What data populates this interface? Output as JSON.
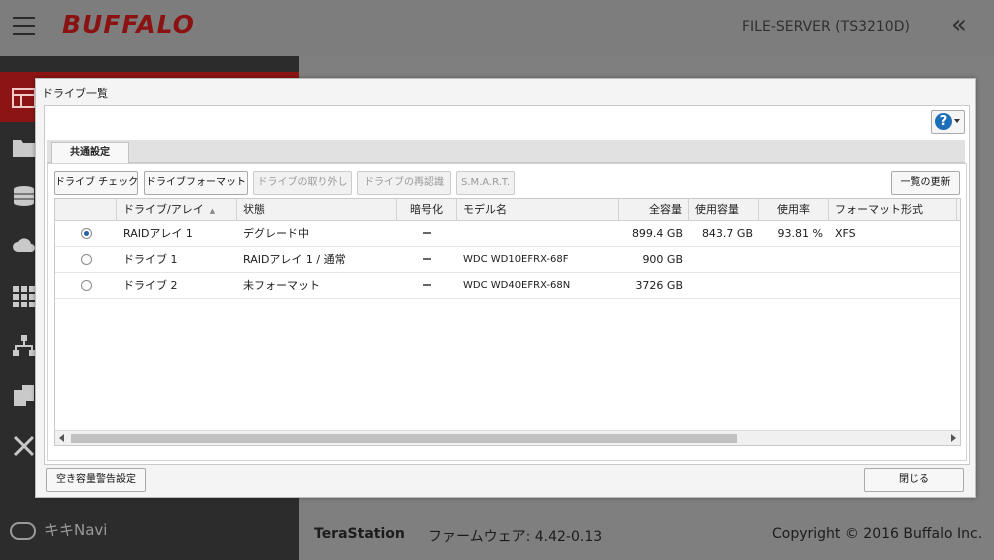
{
  "app": {
    "logo": "BUFFALO",
    "device_name": "FILE-SERVER (TS3210D)",
    "collapse_glyph": "«",
    "navi_label": "キキNavi",
    "footer_brand": "TeraStation",
    "footer_firmware": "ファームウェア: 4.42-0.13",
    "footer_copyright": "Copyright © 2016 Buffalo Inc.",
    "sidebar_icons": [
      "dashboard-icon",
      "folder-icon",
      "drive-icon",
      "cloud-sync-icon",
      "apps-grid-icon",
      "network-icon",
      "backup-icon",
      "tools-icon"
    ],
    "accent_color": "#8c1414"
  },
  "dialog": {
    "title": "ドライブ一覧",
    "tab_label": "共通設定",
    "toolbar": {
      "check": "ドライブ チェック",
      "format": "ドライブフォーマット",
      "remove": "ドライブの取り外し",
      "rescan": "ドライブの再認識",
      "smart": "S.M.A.R.T.",
      "refresh": "一覧の更新"
    },
    "columns": [
      "ドライブ/アレイ",
      "状態",
      "暗号化",
      "モデル名",
      "全容量",
      "使用容量",
      "使用率",
      "フォーマット形式"
    ],
    "rows": [
      {
        "name": "RAIDアレイ 1",
        "status": "デグレード中",
        "encryption": "−",
        "model": "",
        "total": "899.4 GB",
        "used": "843.7 GB",
        "usage": "93.81 %",
        "format": "XFS",
        "selected": true
      },
      {
        "name": "ドライブ 1",
        "status": "RAIDアレイ 1 / 通常",
        "encryption": "−",
        "model": "WDC WD10EFRX-68F",
        "total": "900 GB",
        "used": "",
        "usage": "",
        "format": "",
        "selected": false
      },
      {
        "name": "ドライブ 2",
        "status": "未フォーマット",
        "encryption": "−",
        "model": "WDC WD40EFRX-68N",
        "total": "3726 GB",
        "used": "",
        "usage": "",
        "format": "",
        "selected": false
      }
    ],
    "warning_button": "空き容量警告設定",
    "close_button": "閉じる"
  }
}
